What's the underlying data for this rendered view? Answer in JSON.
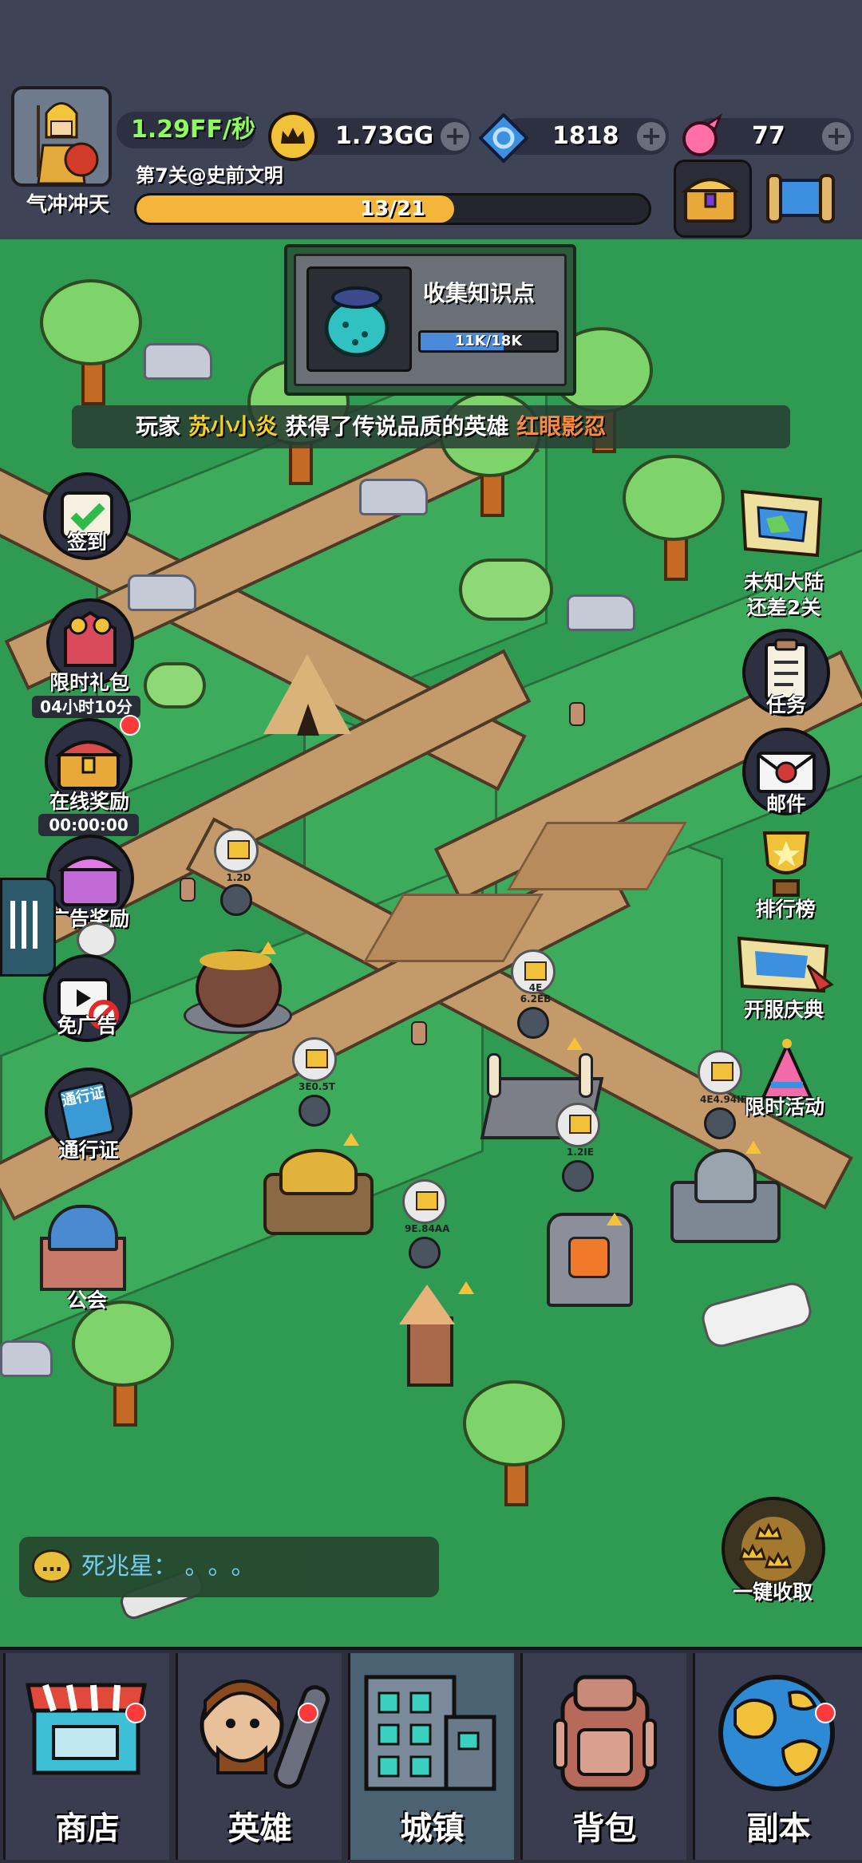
{
  "player": {
    "name": "气冲冲天",
    "income_rate": "1.29FF/秒",
    "level_text": "第7关@史前文明",
    "progress_text": "13/21",
    "progress_fraction": 0.62
  },
  "resources": {
    "gold": "1.73GG",
    "gems": "1818",
    "candy": "77"
  },
  "quest_popup": {
    "title": "收集知识点",
    "progress_text": "11K/18K",
    "progress_fraction": 0.61
  },
  "announcement": {
    "prefix": "玩家",
    "player": "苏小小炎",
    "middle": "获得了传说品质的英雄",
    "hero": "红眼影忍"
  },
  "left_menu": {
    "checkin": "签到",
    "limited_pack": "限时礼包",
    "limited_pack_timer": "04小时10分",
    "online_reward": "在线奖励",
    "online_timer": "00:00:00",
    "ad_reward": "广告奖励",
    "no_ads": "免广告",
    "pass": "通行证",
    "pass_icon_text": "通行证",
    "guild": "公会"
  },
  "right_menu": {
    "unknown_continent": "未知大陆",
    "unknown_continent_sub": "还差2关",
    "tasks": "任务",
    "mail": "邮件",
    "leaderboard": "排行榜",
    "server_celebration": "开服庆典",
    "limited_event": "限时活动",
    "collect_all": "一键收取"
  },
  "buildings": [
    {
      "name": "cauldron",
      "value": "1.2D"
    },
    {
      "name": "war-hut",
      "value": "3E0.5T"
    },
    {
      "name": "totem",
      "value": "9E.84AA"
    },
    {
      "name": "arena",
      "value": "4E 6.2EB"
    },
    {
      "name": "forge",
      "value": "1.2IE"
    },
    {
      "name": "stone-temple",
      "value": "4E4.94IF"
    }
  ],
  "chat": {
    "name": "死兆星",
    "message": "。。。"
  },
  "nav": {
    "shop": "商店",
    "heroes": "英雄",
    "town": "城镇",
    "bag": "背包",
    "dungeon": "副本"
  },
  "colors": {
    "grass": "#2f9a52",
    "path": "#c49a6b",
    "topbar": "#3e4356",
    "progress": "#f5b53a",
    "rate": "#8cff5a",
    "announce_highlight": "#f5d020",
    "announce_hero": "#ff5a3a"
  }
}
